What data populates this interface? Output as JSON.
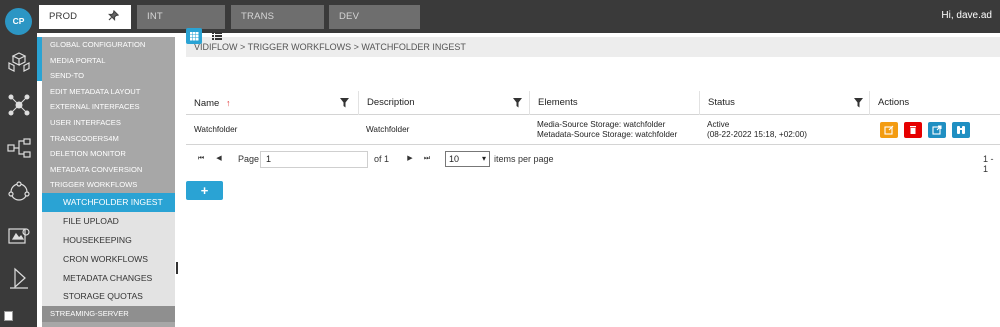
{
  "app": {
    "logo_text": "CP",
    "user_greeting": "Hi, dave.ad"
  },
  "env_tabs": [
    {
      "label": "PROD",
      "active": true
    },
    {
      "label": "INT",
      "active": false
    },
    {
      "label": "TRANS",
      "active": false
    },
    {
      "label": "DEV",
      "active": false
    }
  ],
  "left_icons": [
    "cubes-icon",
    "network-icon",
    "workflow-icon",
    "nodes-icon",
    "media-settings-icon",
    "deploy-icon"
  ],
  "nav": {
    "items": [
      "GLOBAL CONFIGURATION",
      "MEDIA PORTAL",
      "SEND-TO",
      "EDIT METADATA LAYOUT",
      "EXTERNAL INTERFACES",
      "USER INTERFACES",
      "TRANSCODERS4M",
      "DELETION MONITOR",
      "METADATA CONVERSION",
      "TRIGGER WORKFLOWS"
    ],
    "sub_items": [
      {
        "label": "WATCHFOLDER INGEST",
        "active": true
      },
      {
        "label": "FILE UPLOAD",
        "active": false
      },
      {
        "label": "HOUSEKEEPING",
        "active": false
      },
      {
        "label": "CRON WORKFLOWS",
        "active": false
      },
      {
        "label": "METADATA CHANGES",
        "active": false
      },
      {
        "label": "STORAGE QUOTAS",
        "active": false
      }
    ],
    "bottom_item": "STREAMING-SERVER"
  },
  "breadcrumb": "VIDIFLOW > TRIGGER WORKFLOWS > WATCHFOLDER INGEST",
  "grid": {
    "columns": [
      "Name",
      "Description",
      "Elements",
      "Status",
      "Actions"
    ],
    "rows": [
      {
        "name": "Watchfolder",
        "description": "Watchfolder",
        "elements": [
          "Media-Source Storage: watchfolder",
          "Metadata-Source Storage: watchfolder"
        ],
        "status": "Active",
        "status_date": "(08-22-2022 15:18, +02:00)"
      }
    ],
    "action_buttons": [
      {
        "icon": "edit-icon",
        "color": "#f39c12"
      },
      {
        "icon": "delete-icon",
        "color": "#e60000"
      },
      {
        "icon": "open-external-icon",
        "color": "#1f8fc2"
      },
      {
        "icon": "binoculars-icon",
        "color": "#1f8fc2"
      }
    ]
  },
  "pager": {
    "page_label": "Page",
    "page_value": "1",
    "of_label": "of 1",
    "page_size": "10",
    "items_per_page_label": "items per page",
    "range_label": "1 - 1"
  },
  "add_button_label": "+",
  "colors": {
    "accent": "#2aa3d4",
    "topbar": "#3a3a3a",
    "nav": "#a7a7a7"
  }
}
